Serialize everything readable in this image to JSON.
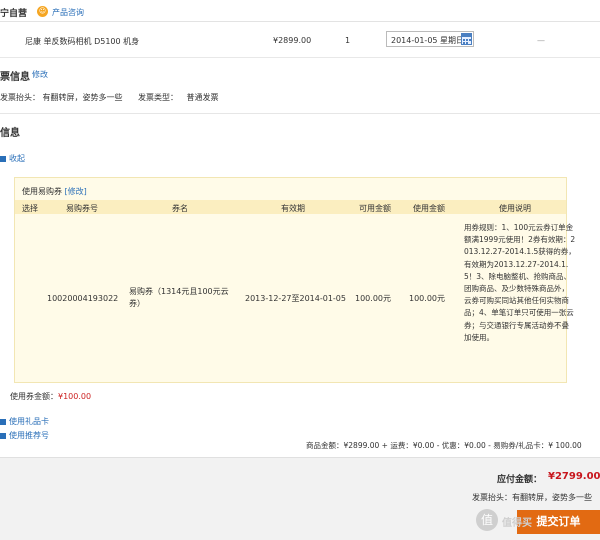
{
  "store": {
    "name": "宁自营",
    "consult_label": "产品咨询"
  },
  "product": {
    "name": "尼康 单反数码相机 D5100 机身",
    "price": "¥2899.00",
    "quantity": "1",
    "delivery_date": "2014-01-05 星期日",
    "extra": "—"
  },
  "invoice": {
    "title": "票信息",
    "edit_label": "修改",
    "header_label": "发票抬头：",
    "header_value": "有翻转屏，姿势多一些",
    "type_label": "发票类型：",
    "type_value": "普通发票"
  },
  "payment": {
    "title": "信息",
    "collapse_label": "收起",
    "coupon_header": "使用易购券",
    "coupon_edit": "[修改]",
    "columns": [
      "选择",
      "易购券号",
      "券名",
      "有效期",
      "可用金额",
      "使用金额",
      "使用说明"
    ],
    "coupon": {
      "number": "10020004193022",
      "name": "易购券（1314元且100元云券）",
      "validity": "2013-12-27至2014-01-05",
      "available": "100.00元",
      "used": "100.00元",
      "rules": "用券规则：1、100元云券订单金额满1999元使用！2券有效期：2013.12.27-2014.1.5获得的券，有效期为2013.12.27-2014.1.5！3、除电脑整机、抢购商品、团购商品、及少数特殊商品外，云券可购买同站其他任何实物商品；4、单笔订单只可使用一张云券；与交通银行专属活动券不叠加使用。"
    },
    "used_amount_label": "使用券金额：",
    "used_amount_value": "¥100.00",
    "gift_card_label": "使用礼品卡",
    "referral_label": "使用推荐号",
    "totals_line": "商品金额：¥2899.00 + 运费：¥0.00 - 优惠：¥0.00 - 易购券/礼品卡：¥ 100.00"
  },
  "summary": {
    "payable_label": "应付金额：",
    "payable_value": "¥2799.00",
    "invoice_label": "发票抬头：",
    "invoice_value": "有翻转屏，姿势多一些",
    "submit_label": "提交订单",
    "watermark": "值得买"
  },
  "colors": {
    "accent": "#e26a12",
    "price_red": "#c8161d",
    "link": "#2a6fb8",
    "coupon_bg": "#fffbe8"
  }
}
